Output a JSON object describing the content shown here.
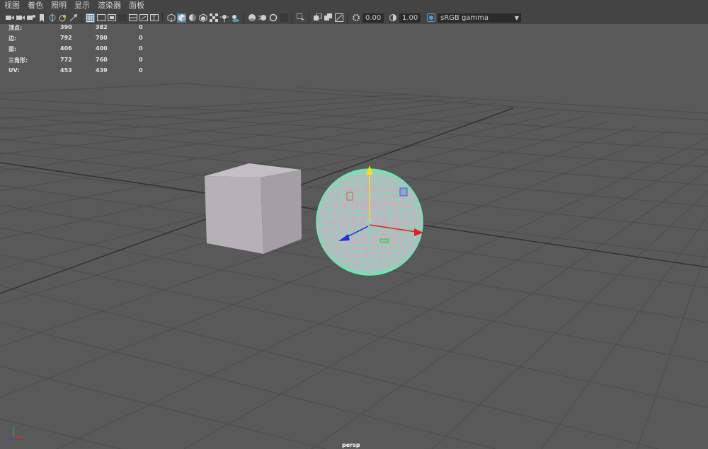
{
  "menu": [
    "视图",
    "着色",
    "照明",
    "显示",
    "渲染器",
    "面板"
  ],
  "toolbar": {
    "exposure_value": "0.00",
    "gamma_value": "1.00",
    "color_space": "sRGB gamma",
    "icons": [
      "camera-select-icon",
      "camera-attributes-icon",
      "bookmark-icon",
      "image-plane-icon",
      "film-gate-icon",
      "resolution-gate-icon",
      "grid-toggle-icon",
      "wireframe-icon",
      "smooth-shade-icon",
      "textured-icon",
      "lights-icon",
      "shadows-icon",
      "isolate-icon",
      "xray-icon",
      "backface-icon",
      "exposure-icon",
      "gamma-icon",
      "color-management-icon"
    ]
  },
  "hud": {
    "rows": [
      {
        "label": "顶点:",
        "values": [
          "390",
          "382",
          "0"
        ]
      },
      {
        "label": "边:",
        "values": [
          "792",
          "780",
          "0"
        ]
      },
      {
        "label": "面:",
        "values": [
          "406",
          "400",
          "0"
        ]
      },
      {
        "label": "三角形:",
        "values": [
          "772",
          "760",
          "0"
        ]
      },
      {
        "label": "UV:",
        "values": [
          "453",
          "439",
          "0"
        ]
      }
    ]
  },
  "viewport": {
    "camera": "persp",
    "colors": {
      "background": "#595959",
      "grid": "#4a4a4a",
      "grid_axis": "#2f2f2f",
      "cube": "#b3aeb4",
      "sphere_wire": "#5cf2b0",
      "manip_x": "#e02020",
      "manip_y": "#f0e020",
      "manip_z": "#2030e0"
    }
  }
}
